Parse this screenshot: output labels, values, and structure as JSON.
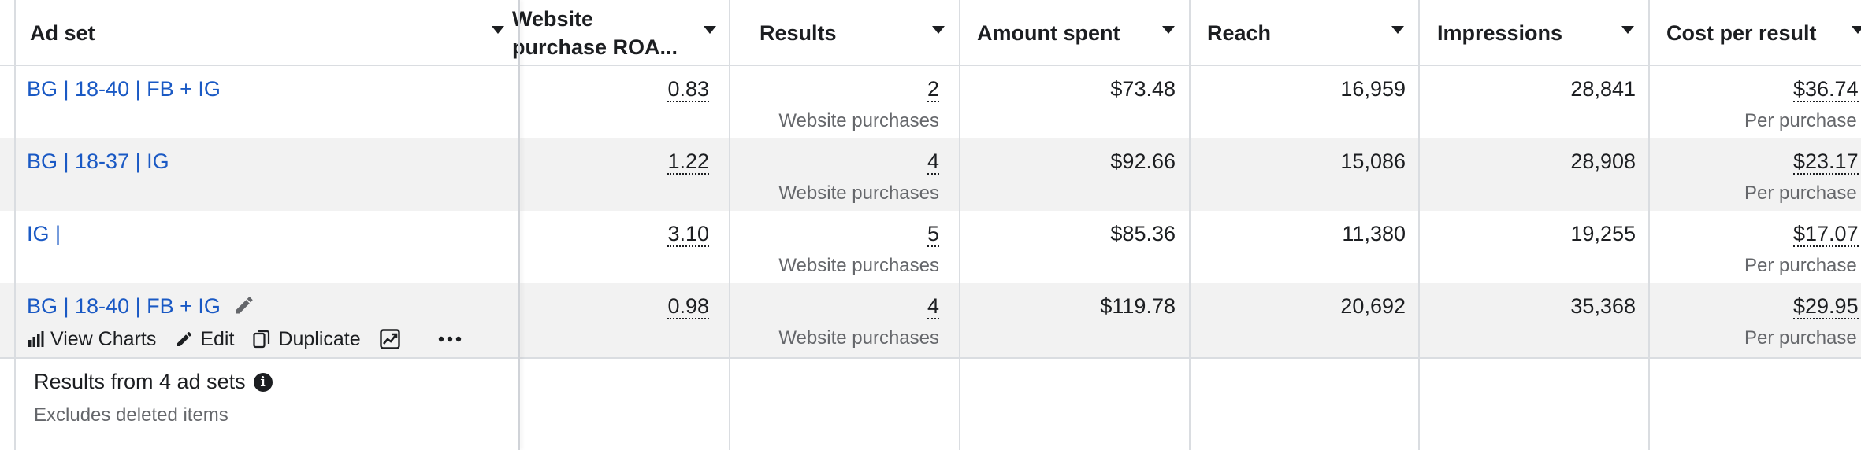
{
  "columns": {
    "adset": "Ad set",
    "roas_line1": "Website",
    "roas_line2": "purchase ROA...",
    "results": "Results",
    "amount": "Amount spent",
    "reach": "Reach",
    "impressions": "Impressions",
    "cpr": "Cost per result"
  },
  "rows": [
    {
      "name": "BG | 18-40 | FB + IG",
      "roas": "0.83",
      "results": "2",
      "results_sub": "Website purchases",
      "amount": "$73.48",
      "reach": "16,959",
      "impressions": "28,841",
      "cpr": "$36.74",
      "cpr_sub": "Per purchase"
    },
    {
      "name": "BG | 18-37 | IG",
      "roas": "1.22",
      "results": "4",
      "results_sub": "Website purchases",
      "amount": "$92.66",
      "reach": "15,086",
      "impressions": "28,908",
      "cpr": "$23.17",
      "cpr_sub": "Per purchase"
    },
    {
      "name": "IG |",
      "roas": "3.10",
      "results": "5",
      "results_sub": "Website purchases",
      "amount": "$85.36",
      "reach": "11,380",
      "impressions": "19,255",
      "cpr": "$17.07",
      "cpr_sub": "Per purchase"
    },
    {
      "name": "BG | 18-40 | FB + IG",
      "roas": "0.98",
      "results": "4",
      "results_sub": "Website purchases",
      "amount": "$119.78",
      "reach": "20,692",
      "impressions": "35,368",
      "cpr": "$29.95",
      "cpr_sub": "Per purchase"
    }
  ],
  "row_actions": {
    "view_charts": "View Charts",
    "edit": "Edit",
    "duplicate": "Duplicate"
  },
  "footer": {
    "title": "Results from 4 ad sets",
    "subtitle": "Excludes deleted items"
  },
  "icons": {
    "edit_pencil": "pencil-icon",
    "view_charts": "bar-chart-icon",
    "edit": "pencil-icon",
    "duplicate": "duplicate-icon",
    "trend": "trend-chart-icon",
    "more": "more-horizontal-icon",
    "info": "info-icon",
    "sort": "caret-down-icon"
  },
  "colors": {
    "link": "#1a59c4",
    "row_alt": "#f2f2f2",
    "divider": "#dadde1",
    "muted": "#65676b"
  }
}
